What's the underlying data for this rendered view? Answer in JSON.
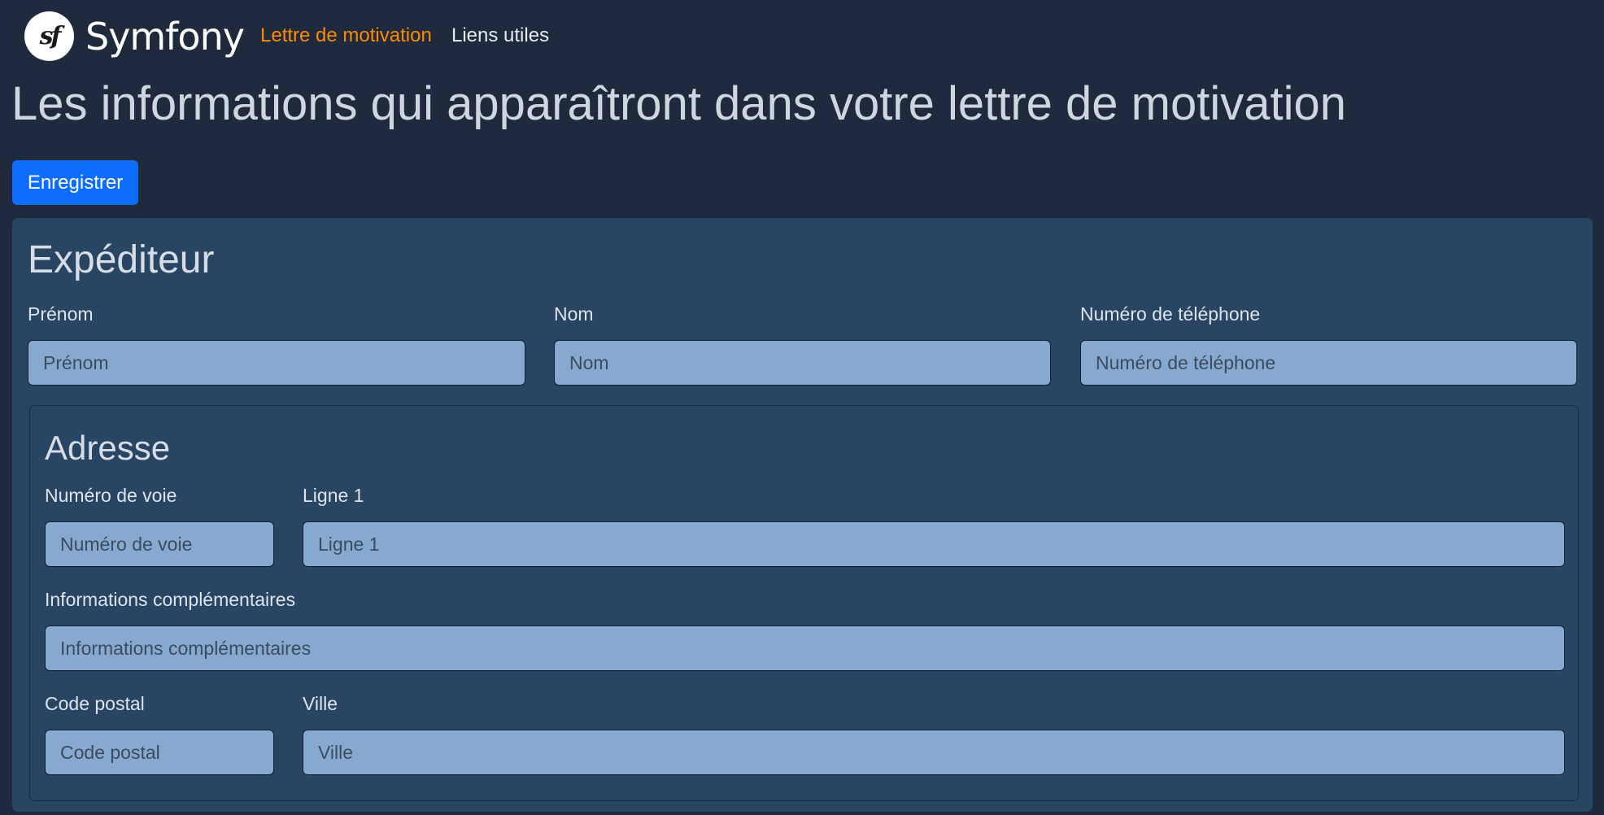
{
  "nav": {
    "brand": "Symfony",
    "logo_glyph": "sf",
    "links": [
      {
        "label": "Lettre de motivation",
        "active": true,
        "color": "#ff8a00"
      },
      {
        "label": "Liens utiles",
        "active": false
      }
    ]
  },
  "page": {
    "title": "Les informations qui apparaîtront dans votre lettre de motivation",
    "save_label": "Enregistrer"
  },
  "sender": {
    "title": "Expéditeur",
    "fields": {
      "firstname": {
        "label": "Prénom",
        "placeholder": "Prénom",
        "value": ""
      },
      "lastname": {
        "label": "Nom",
        "placeholder": "Nom",
        "value": ""
      },
      "phone": {
        "label": "Numéro de téléphone",
        "placeholder": "Numéro de téléphone",
        "value": ""
      }
    }
  },
  "address": {
    "title": "Adresse",
    "fields": {
      "street_number": {
        "label": "Numéro de voie",
        "placeholder": "Numéro de voie",
        "value": ""
      },
      "line1": {
        "label": "Ligne 1",
        "placeholder": "Ligne 1",
        "value": ""
      },
      "extra": {
        "label": "Informations complémentaires",
        "placeholder": "Informations complémentaires",
        "value": ""
      },
      "postal_code": {
        "label": "Code postal",
        "placeholder": "Code postal",
        "value": ""
      },
      "city": {
        "label": "Ville",
        "placeholder": "Ville",
        "value": ""
      }
    }
  },
  "colors": {
    "background": "#1f2a3c",
    "panel": "#284563",
    "input": "#87a8cf",
    "primary_button": "#0d6efd",
    "active_link": "#ff8a00"
  }
}
